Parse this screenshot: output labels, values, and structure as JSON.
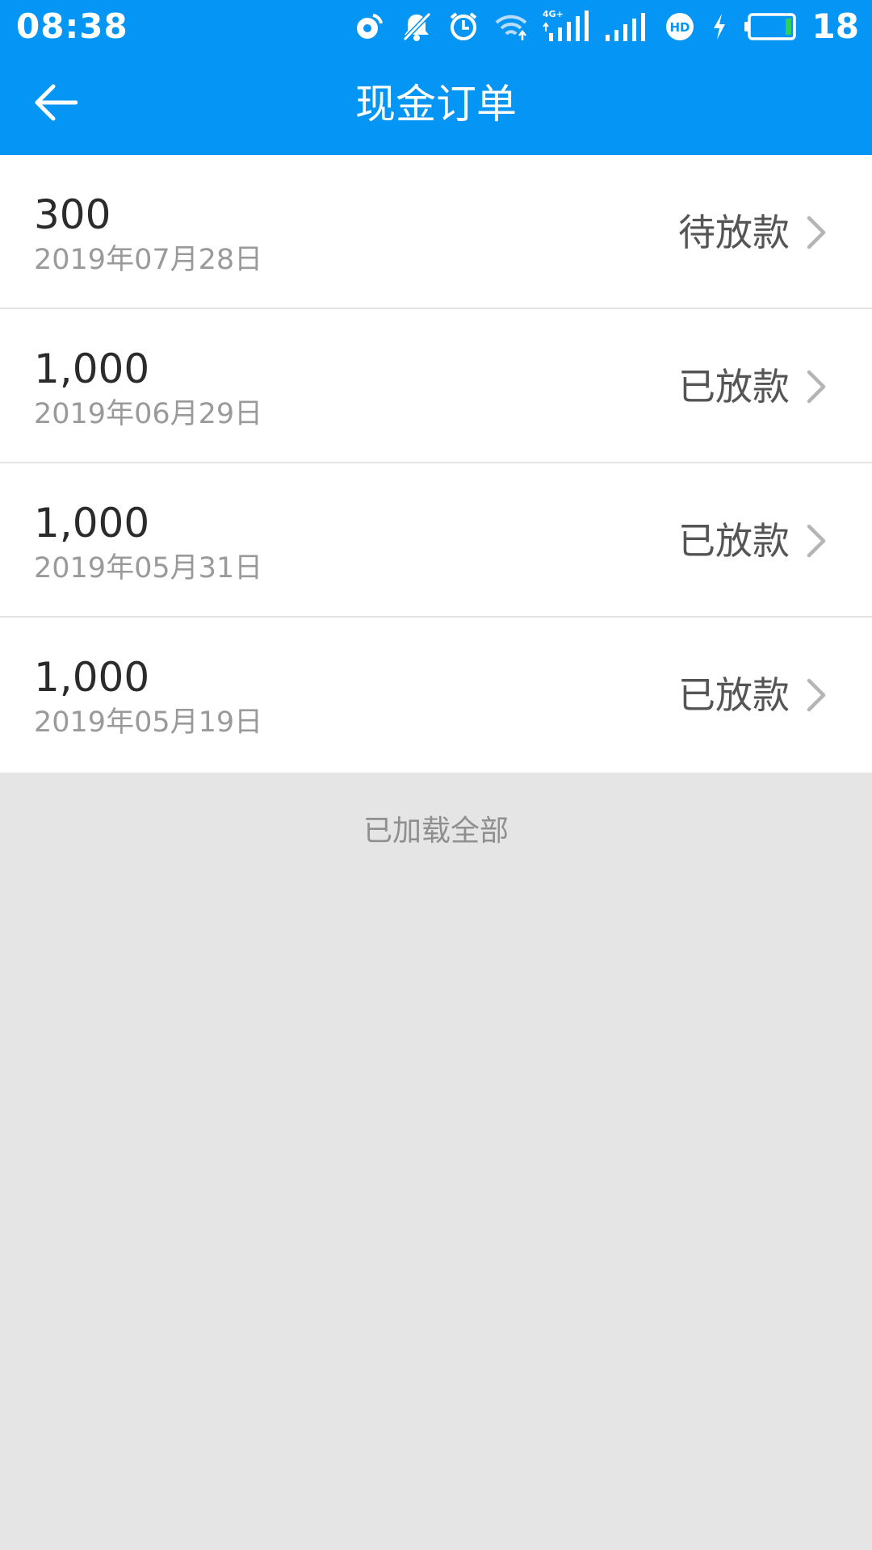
{
  "status_bar": {
    "time": "08:38",
    "battery_level": "18",
    "icons": [
      "nfc-icon",
      "mute-icon",
      "alarm-icon",
      "wifi-icon",
      "signal-4g-icon",
      "signal-icon",
      "hd-icon",
      "charging-icon",
      "battery-icon"
    ],
    "signal_label": "4G+",
    "hd_label": "HD"
  },
  "header": {
    "title": "现金订单",
    "back_icon": "arrow-left-icon"
  },
  "orders": [
    {
      "amount": "300",
      "date": "2019年07月28日",
      "status": "待放款"
    },
    {
      "amount": "1,000",
      "date": "2019年06月29日",
      "status": "已放款"
    },
    {
      "amount": "1,000",
      "date": "2019年05月31日",
      "status": "已放款"
    },
    {
      "amount": "1,000",
      "date": "2019年05月19日",
      "status": "已放款"
    }
  ],
  "footer": {
    "loaded_all": "已加载全部"
  },
  "colors": {
    "appbar": "#0596f5",
    "background": "#e5e5e6",
    "amount_text": "#2b2b2b",
    "date_text": "#9a9a9a",
    "status_text": "#555555",
    "battery_fill": "#2fd34a"
  }
}
